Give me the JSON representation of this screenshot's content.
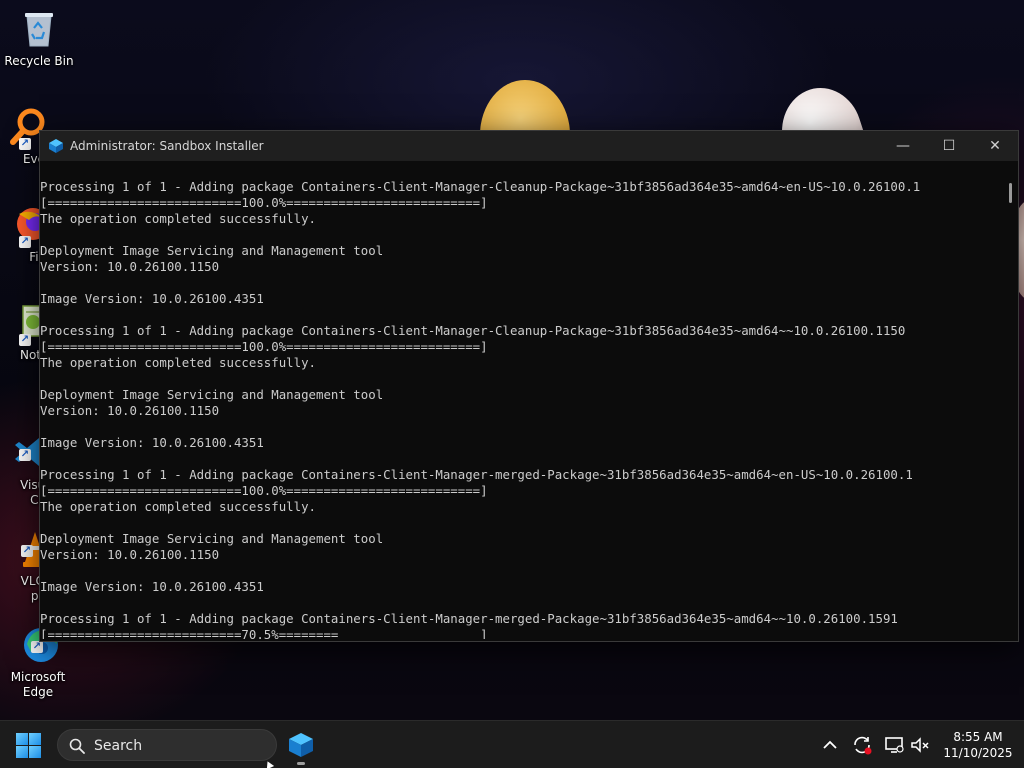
{
  "desktop": {
    "icons": [
      {
        "id": "recycle-bin",
        "label": "Recycle Bin",
        "icon": "recycle-bin-icon"
      },
      {
        "id": "everything",
        "label": "Every",
        "icon": "everything-search-icon"
      },
      {
        "id": "firefox",
        "label": "Fire",
        "icon": "firefox-icon"
      },
      {
        "id": "notepad",
        "label": "Notep",
        "icon": "notepad-plus-plus-icon"
      },
      {
        "id": "vscode",
        "label": "Visual\nCo",
        "icon": "vscode-icon"
      },
      {
        "id": "vlc",
        "label": "VLC m\npla",
        "icon": "vlc-icon"
      },
      {
        "id": "edge",
        "label": "Microsoft\nEdge",
        "icon": "edge-icon"
      }
    ]
  },
  "window": {
    "title": "Administrator:  Sandbox Installer",
    "icon": "sandbox-app-icon",
    "controls": {
      "minimize": "—",
      "maximize": "☐",
      "close": "✕"
    },
    "console_lines": [
      "Processing 1 of 1 - Adding package Containers-Client-Manager-Cleanup-Package~31bf3856ad364e35~amd64~en-US~10.0.26100.1",
      "[==========================100.0%==========================]",
      "The operation completed successfully.",
      "",
      "Deployment Image Servicing and Management tool",
      "Version: 10.0.26100.1150",
      "",
      "Image Version: 10.0.26100.4351",
      "",
      "Processing 1 of 1 - Adding package Containers-Client-Manager-Cleanup-Package~31bf3856ad364e35~amd64~~10.0.26100.1150",
      "[==========================100.0%==========================]",
      "The operation completed successfully.",
      "",
      "Deployment Image Servicing and Management tool",
      "Version: 10.0.26100.1150",
      "",
      "Image Version: 10.0.26100.4351",
      "",
      "Processing 1 of 1 - Adding package Containers-Client-Manager-merged-Package~31bf3856ad364e35~amd64~en-US~10.0.26100.1",
      "[==========================100.0%==========================]",
      "The operation completed successfully.",
      "",
      "Deployment Image Servicing and Management tool",
      "Version: 10.0.26100.1150",
      "",
      "Image Version: 10.0.26100.4351",
      "",
      "Processing 1 of 1 - Adding package Containers-Client-Manager-merged-Package~31bf3856ad364e35~amd64~~10.0.26100.1591",
      "[==========================70.5%========                   ]"
    ]
  },
  "taskbar": {
    "search_label": "Search",
    "start_icon": "windows-start-icon",
    "apps": [
      {
        "id": "sandbox-installer",
        "icon": "sandbox-app-icon"
      }
    ],
    "tray_icons": [
      "chevron-up-icon",
      "sync-icon",
      "display-icon",
      "volume-muted-icon"
    ],
    "time": "8:55 AM",
    "date": "11/10/2025"
  },
  "colors": {
    "console_bg": "#0c0c0c",
    "console_text": "#cccccc",
    "titlebar_bg": "#1f1f1f",
    "taskbar_bg": "#1c1c1c",
    "accent": "#1d8ee6"
  }
}
